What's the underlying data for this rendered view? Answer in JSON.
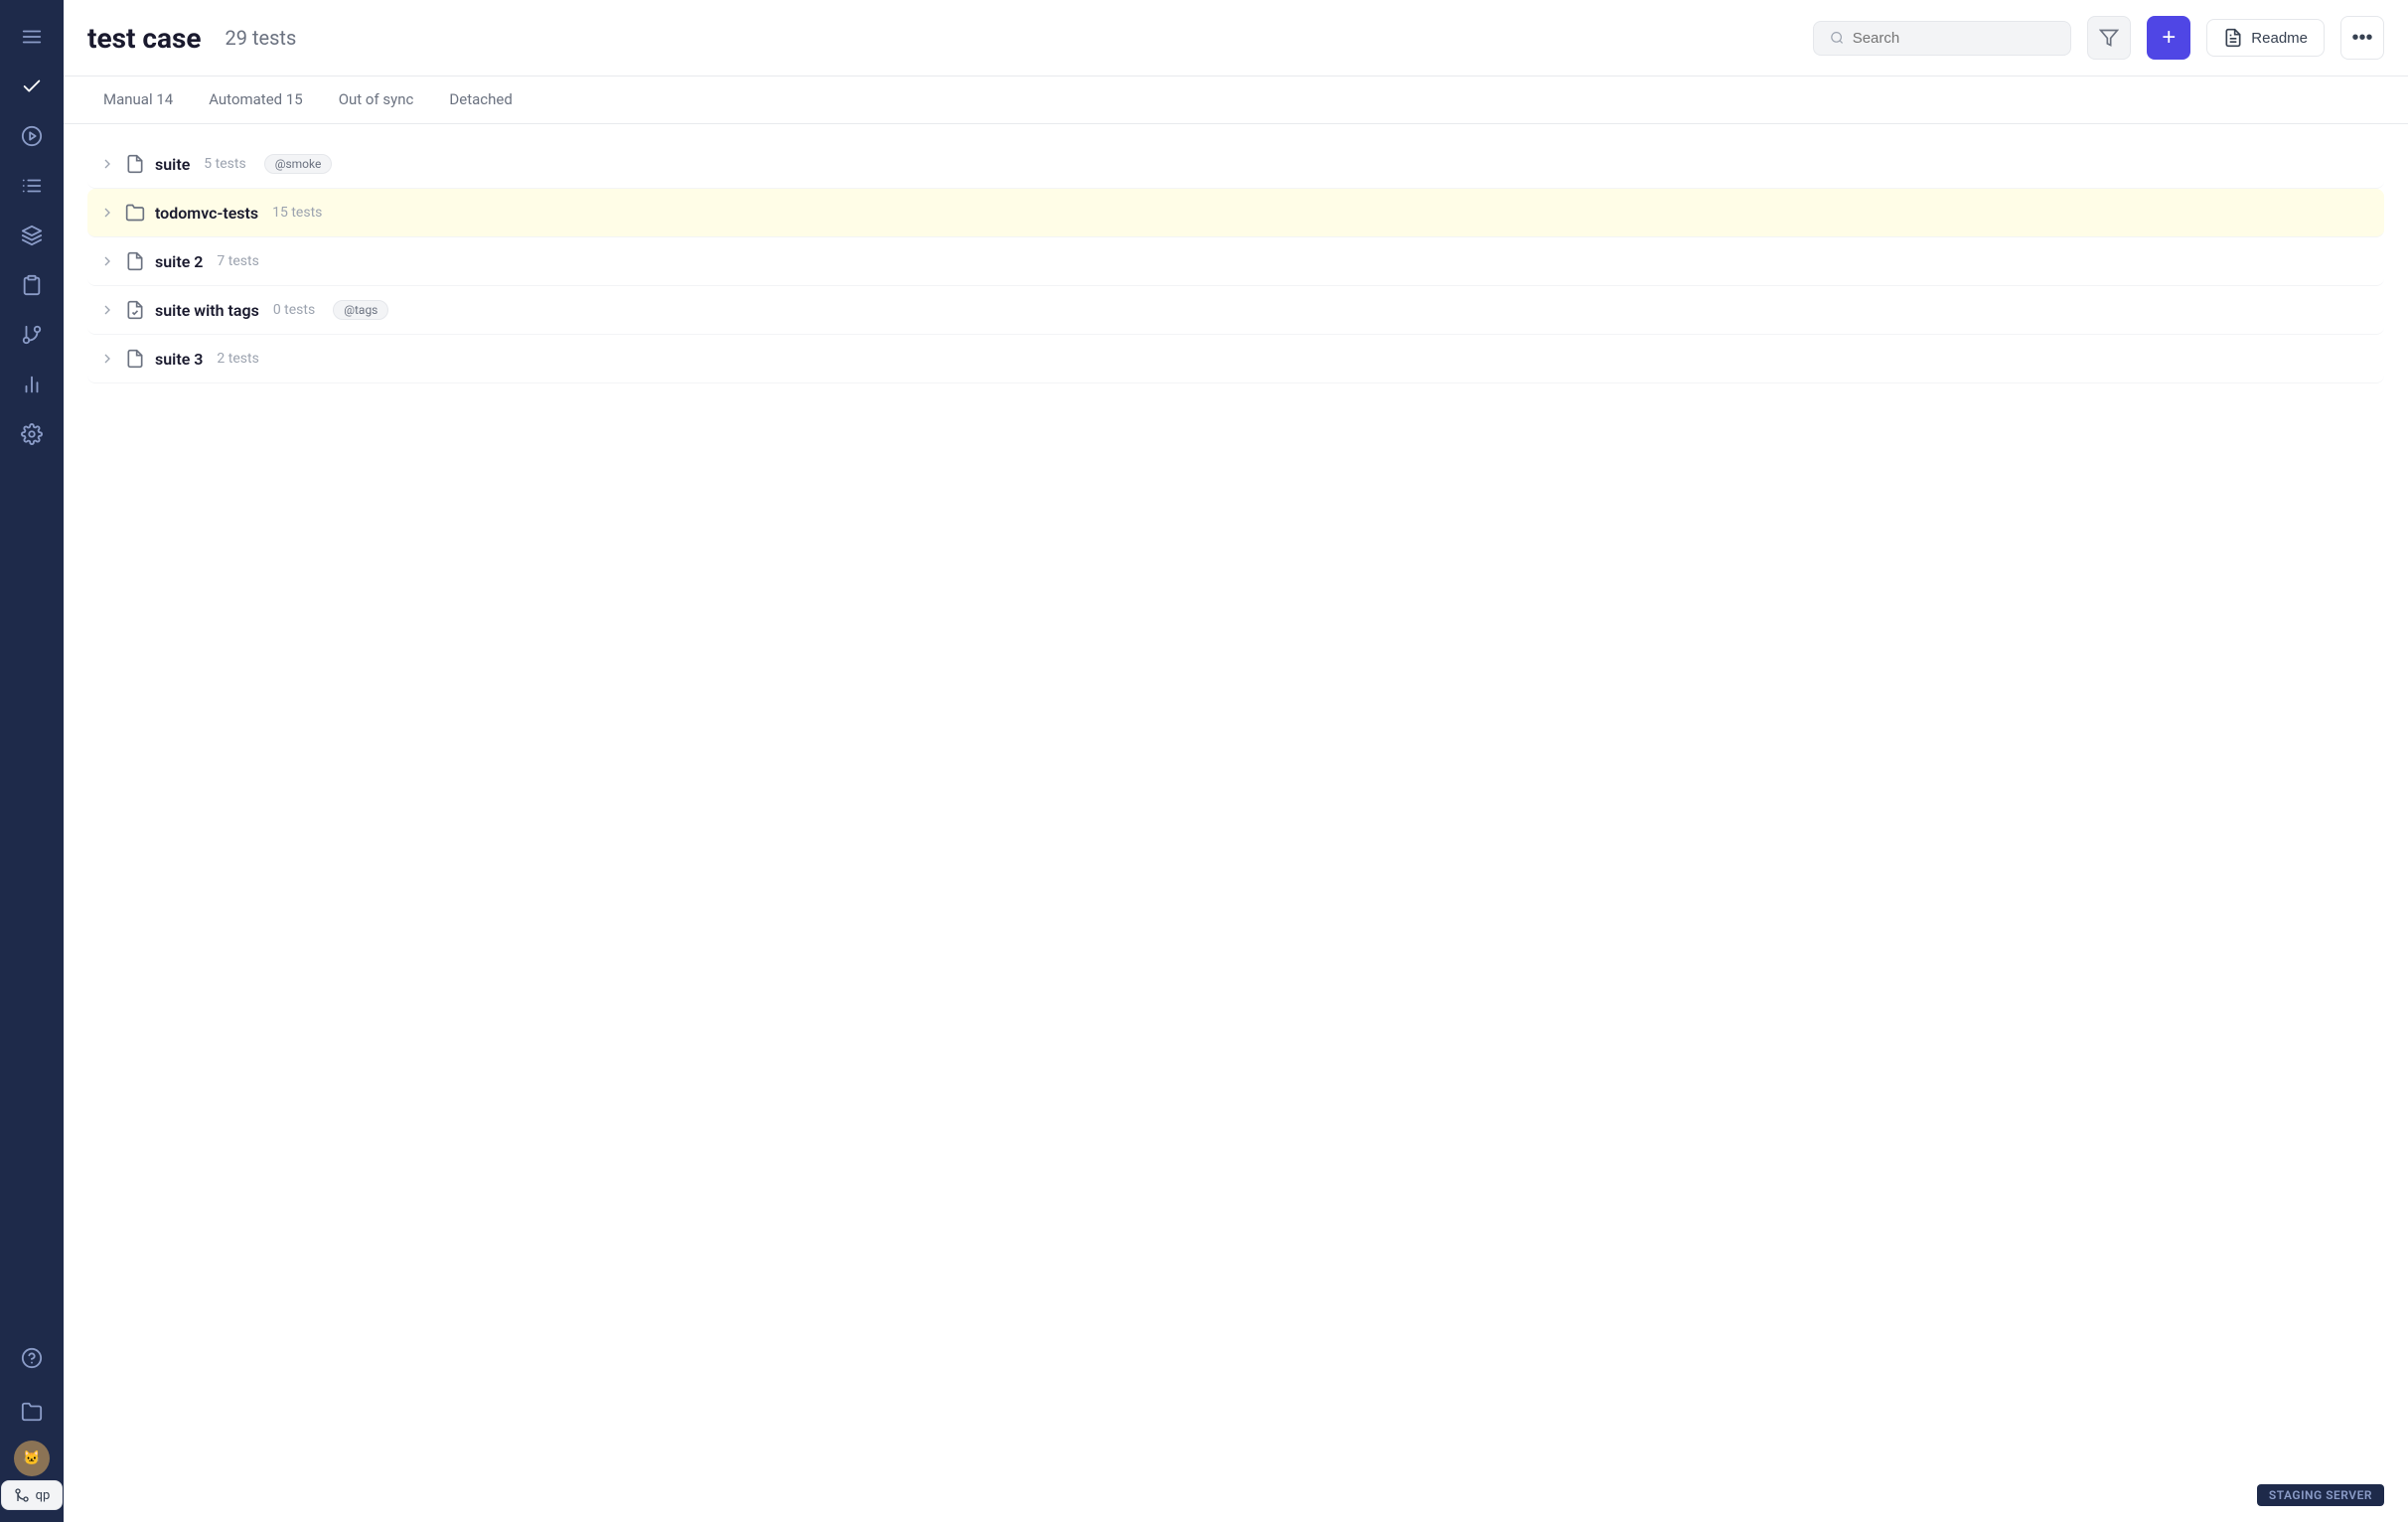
{
  "sidebar": {
    "icons": [
      {
        "name": "menu-icon",
        "label": "Menu"
      },
      {
        "name": "check-icon",
        "label": "Check",
        "active": true
      },
      {
        "name": "play-icon",
        "label": "Play"
      },
      {
        "name": "list-icon",
        "label": "List"
      },
      {
        "name": "layers-icon",
        "label": "Layers"
      },
      {
        "name": "clipboard-icon",
        "label": "Clipboard"
      },
      {
        "name": "git-branch-icon",
        "label": "Git Branch"
      },
      {
        "name": "bar-chart-icon",
        "label": "Bar Chart"
      },
      {
        "name": "settings-icon",
        "label": "Settings"
      }
    ],
    "bottom_icons": [
      {
        "name": "help-icon",
        "label": "Help"
      },
      {
        "name": "folder-icon",
        "label": "Folder"
      }
    ]
  },
  "header": {
    "title": "test case",
    "test_count": "29 tests",
    "search_placeholder": "Search",
    "add_button_label": "+",
    "readme_button_label": "Readme",
    "more_button_label": "..."
  },
  "tabs": [
    {
      "label": "Manual 14",
      "active": false
    },
    {
      "label": "Automated 15",
      "active": false
    },
    {
      "label": "Out of sync",
      "active": false
    },
    {
      "label": "Detached",
      "active": false
    }
  ],
  "suites": [
    {
      "name": "suite",
      "count": "5 tests",
      "tags": [
        "@smoke"
      ],
      "icon": "file",
      "highlighted": false
    },
    {
      "name": "todomvc-tests",
      "count": "15 tests",
      "tags": [],
      "icon": "folder",
      "highlighted": true
    },
    {
      "name": "suite 2",
      "count": "7 tests",
      "tags": [],
      "icon": "file",
      "highlighted": false
    },
    {
      "name": "suite with tags",
      "count": "0 tests",
      "tags": [
        "@tags"
      ],
      "icon": "file-check",
      "highlighted": false
    },
    {
      "name": "suite 3",
      "count": "2 tests",
      "tags": [],
      "icon": "file",
      "highlighted": false
    }
  ],
  "staging": {
    "label": "STAGING SERVER"
  },
  "git_button": {
    "label": "qp"
  }
}
